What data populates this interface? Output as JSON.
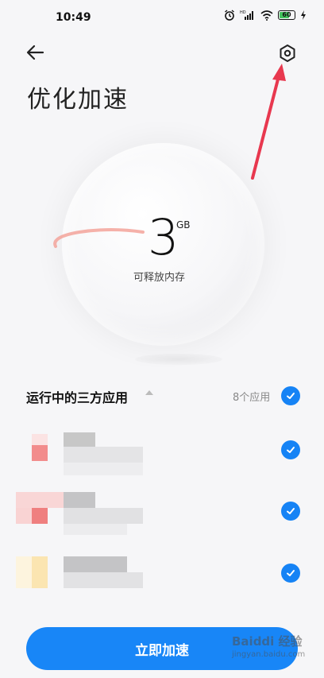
{
  "status_bar": {
    "time": "10:49",
    "battery": "60",
    "icons": [
      "alarm-icon",
      "hd-signal-icon",
      "wifi-icon",
      "battery-icon",
      "charging-icon"
    ]
  },
  "header": {
    "back_icon": "back-arrow-icon",
    "settings_icon": "settings-hexagon-icon",
    "title": "优化加速"
  },
  "memory": {
    "value": "3",
    "unit": "GB",
    "label": "可释放内存"
  },
  "apps_section": {
    "title": "运行中的三方应用",
    "count": "8个应用",
    "all_checked": true,
    "apps": [
      {
        "checked": true
      },
      {
        "checked": true
      },
      {
        "checked": true
      }
    ]
  },
  "primary_action": {
    "label": "立即加速"
  },
  "watermark": {
    "line1": "Baiddi 经验",
    "line2": "jingyan.baidu.com"
  },
  "colors": {
    "accent": "#1886f7",
    "annotation_arrow": "#e8384f",
    "ring": "#f3a39a"
  }
}
